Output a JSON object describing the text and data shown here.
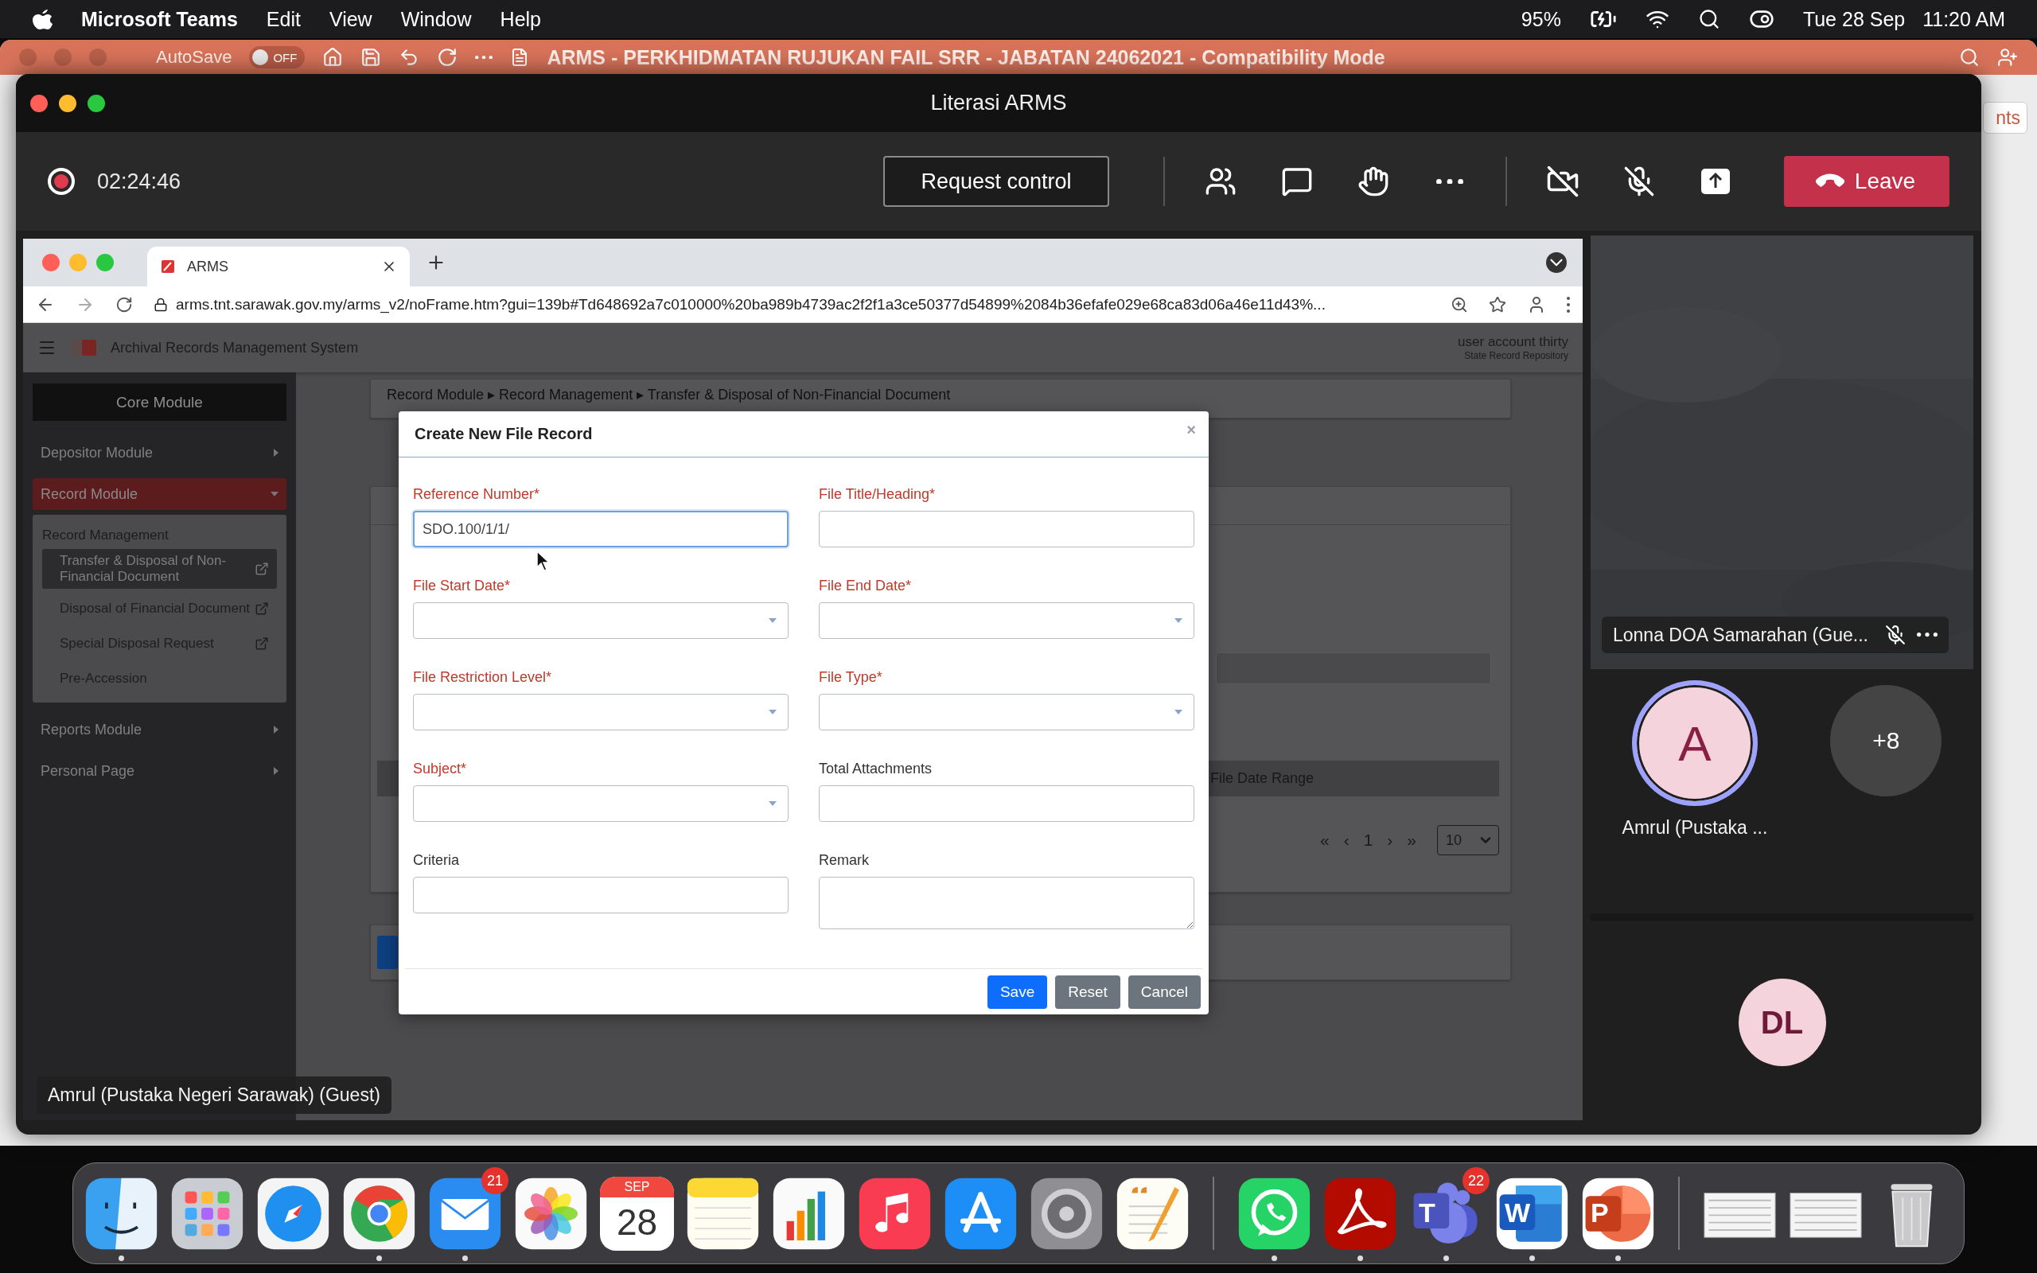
{
  "menu_bar": {
    "app": "Microsoft Teams",
    "menus": [
      "Edit",
      "View",
      "Window",
      "Help"
    ],
    "battery": "95%",
    "date": "Tue 28 Sep",
    "time": "11:20 AM"
  },
  "background_window": {
    "autosave": "AutoSave",
    "autosave_toggle": {
      "label": "OFF",
      "on": false
    },
    "title": "ARMS - PERKHIDMATAN RUJUKAN FAIL SRR - JABATAN 24062021 -  Compatibility Mode",
    "side_button": "nts"
  },
  "meeting": {
    "title": "Literasi ARMS",
    "recording": true,
    "duration": "02:24:46",
    "request_control": "Request control",
    "camera_on": false,
    "mic_on": false,
    "leave": "Leave",
    "shared_screen": {
      "tab": {
        "title": "ARMS"
      },
      "url": "arms.tnt.sarawak.gov.my/arms_v2/noFrame.htm?gui=139b#Td648692a7c010000%20ba989b4739ac2f2f1a3ce50377d54899%2084b36efafe029e68ca83d06a46e11d43%...",
      "app": {
        "title": "Archival Records Management System",
        "user": "user account thirty",
        "user_role": "State Record Repository",
        "sidebar": [
          {
            "label": "Core Module",
            "kind": "header"
          },
          {
            "label": "Depositor Module",
            "kind": "menu",
            "selected": false,
            "expanded": false
          },
          {
            "label": "Record Module",
            "kind": "menu",
            "selected": true,
            "expanded": true,
            "group": "Record Management",
            "children": [
              {
                "label": "Transfer & Disposal of Non-Financial Document",
                "selected": true,
                "external": true
              },
              {
                "label": "Disposal of Financial Document",
                "selected": false,
                "external": true
              },
              {
                "label": "Special Disposal Request",
                "selected": false,
                "external": true
              },
              {
                "label": "Pre-Accession",
                "selected": false,
                "external": false
              }
            ]
          },
          {
            "label": "Reports Module",
            "kind": "menu",
            "selected": false,
            "expanded": false
          },
          {
            "label": "Personal Page",
            "kind": "menu",
            "selected": false,
            "expanded": false
          }
        ],
        "breadcrumb": "Record Module ▸ Record Management ▸ Transfer & Disposal of Non-Financial Document",
        "table": {
          "columns": [
            "File Date Range"
          ]
        },
        "pagination": {
          "controls": [
            "«",
            "‹",
            "1",
            "›",
            "»"
          ],
          "page_size": "10"
        },
        "modal": {
          "title": "Create New File Record",
          "close": "×",
          "fields": [
            {
              "label": "Reference Number*",
              "kind": "text",
              "required": true,
              "value": "SDO.100/1/1/",
              "focused": true
            },
            {
              "label": "File Title/Heading*",
              "kind": "text",
              "required": true,
              "focused": false
            },
            {
              "label": "File Start Date*",
              "kind": "select",
              "required": true,
              "focused": false
            },
            {
              "label": "File End Date*",
              "kind": "select",
              "required": true,
              "focused": false
            },
            {
              "label": "File Restriction Level*",
              "kind": "select",
              "required": true,
              "focused": false
            },
            {
              "label": "File Type*",
              "kind": "select",
              "required": true,
              "focused": false
            },
            {
              "label": "Subject*",
              "kind": "select",
              "required": true,
              "focused": false
            },
            {
              "label": "Total Attachments",
              "kind": "text",
              "required": false,
              "focused": false
            },
            {
              "label": "Criteria",
              "kind": "text",
              "required": false,
              "focused": false
            },
            {
              "label": "Remark",
              "kind": "textarea",
              "required": false,
              "focused": false
            }
          ],
          "buttons": [
            {
              "label": "Save",
              "kind": "primary"
            },
            {
              "label": "Reset",
              "kind": "secondary"
            },
            {
              "label": "Cancel",
              "kind": "secondary"
            }
          ]
        }
      }
    },
    "presenter_label": "Amrul (Pustaka Negeri Sarawak) (Guest)",
    "participants": [
      {
        "kind": "video",
        "name": "Lonna DOA Samarahan (Gue...",
        "muted": true
      },
      {
        "kind": "avatar",
        "initials": "A",
        "name": "Amrul (Pustaka ...",
        "speaking": true
      },
      {
        "kind": "overflow",
        "label": "+8"
      },
      {
        "kind": "tile",
        "initials": "DL"
      }
    ]
  },
  "dock": [
    {
      "kind": "finder",
      "running": true
    },
    {
      "kind": "launchpad",
      "running": false
    },
    {
      "kind": "safari",
      "running": false
    },
    {
      "kind": "chrome",
      "running": true
    },
    {
      "kind": "mail",
      "running": true,
      "badge": "21"
    },
    {
      "kind": "photos",
      "running": false
    },
    {
      "kind": "calendar",
      "running": false,
      "month": "SEP",
      "day": "28"
    },
    {
      "kind": "notes",
      "running": false
    },
    {
      "kind": "numbers",
      "running": false
    },
    {
      "kind": "music",
      "running": false
    },
    {
      "kind": "appstore",
      "running": false
    },
    {
      "kind": "settings",
      "running": false
    },
    {
      "kind": "editor",
      "running": false
    },
    {
      "kind": "divider"
    },
    {
      "kind": "whatsapp",
      "running": true
    },
    {
      "kind": "acrobat",
      "running": true
    },
    {
      "kind": "teams",
      "running": true,
      "badge": "22",
      "letter": "T"
    },
    {
      "kind": "word",
      "running": true,
      "letter": "W"
    },
    {
      "kind": "powerpoint",
      "running": true,
      "letter": "P"
    },
    {
      "kind": "divider"
    },
    {
      "kind": "thumbnail",
      "running": false
    },
    {
      "kind": "thumbnail",
      "running": false
    },
    {
      "kind": "trash",
      "running": false
    }
  ]
}
